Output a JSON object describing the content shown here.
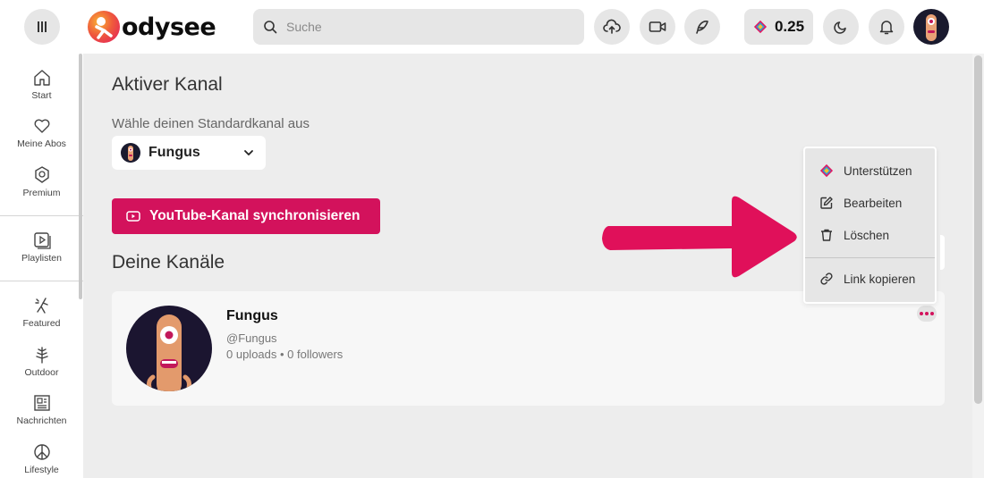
{
  "header": {
    "logo_text": "odysee",
    "search_placeholder": "Suche",
    "credits": "0.25"
  },
  "sidebar": {
    "items": [
      {
        "label": "Start",
        "icon": "home-icon"
      },
      {
        "label": "Meine Abos",
        "icon": "heart-icon"
      },
      {
        "label": "Premium",
        "icon": "premium-icon"
      },
      {
        "label": "Playlisten",
        "icon": "playlist-icon"
      },
      {
        "label": "Featured",
        "icon": "featured-icon"
      },
      {
        "label": "Outdoor",
        "icon": "tree-icon"
      },
      {
        "label": "Nachrichten",
        "icon": "news-icon"
      },
      {
        "label": "Lifestyle",
        "icon": "peace-icon"
      }
    ]
  },
  "main": {
    "active_heading": "Aktiver Kanal",
    "select_label": "Wähle deinen Standardkanal aus",
    "selected_channel": "Fungus",
    "youtube_sync_label": "YouTube-Kanal synchronisieren",
    "channels_heading": "Deine Kanäle",
    "channel": {
      "name": "Fungus",
      "handle": "@Fungus",
      "stats": "0 uploads • 0 followers"
    }
  },
  "context_menu": {
    "items": [
      {
        "label": "Unterstützen",
        "icon": "support-icon"
      },
      {
        "label": "Bearbeiten",
        "icon": "edit-icon"
      },
      {
        "label": "Löschen",
        "icon": "trash-icon"
      },
      {
        "label": "Link kopieren",
        "icon": "link-icon"
      }
    ]
  },
  "colors": {
    "accent": "#d3125c",
    "arrow": "#e0105a",
    "background": "#ededed"
  }
}
